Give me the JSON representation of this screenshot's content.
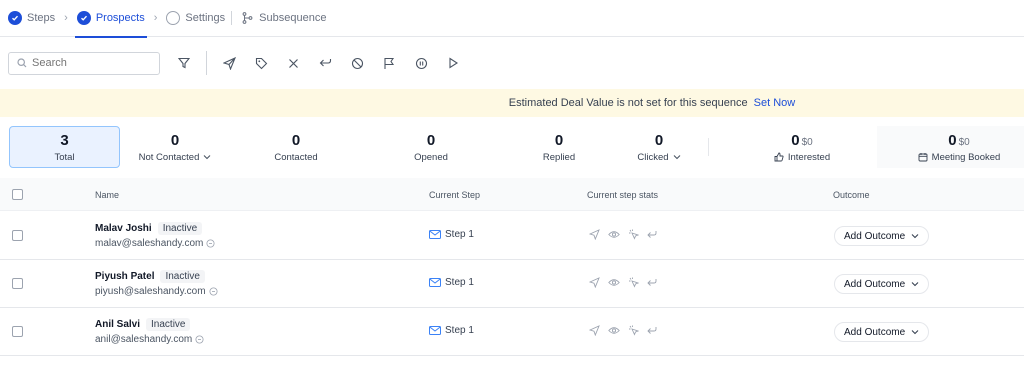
{
  "tabs": [
    {
      "label": "Steps",
      "state": "done"
    },
    {
      "label": "Prospects",
      "state": "active"
    },
    {
      "label": "Settings",
      "state": "empty"
    },
    {
      "label": "Subsequence",
      "state": "branch"
    }
  ],
  "toolbar": {
    "search_placeholder": "Search",
    "icons": [
      "filter-icon",
      "send-icon",
      "tag-icon",
      "close-icon",
      "reply-icon",
      "block-icon",
      "flag-icon",
      "pause-icon",
      "play-icon"
    ]
  },
  "banner": {
    "text": "Estimated Deal Value is not set for this sequence",
    "link": "Set Now"
  },
  "stats": {
    "total": {
      "value": "3",
      "label": "Total"
    },
    "not_contacted": {
      "value": "0",
      "label": "Not Contacted"
    },
    "contacted": {
      "value": "0",
      "label": "Contacted"
    },
    "opened": {
      "value": "0",
      "label": "Opened"
    },
    "replied": {
      "value": "0",
      "label": "Replied"
    },
    "clicked": {
      "value": "0",
      "label": "Clicked"
    },
    "interested": {
      "value": "0",
      "amount": "$0",
      "label": "Interested"
    },
    "meeting_booked": {
      "value": "0",
      "amount": "$0",
      "label": "Meeting Booked"
    }
  },
  "table": {
    "headers": {
      "name": "Name",
      "current_step": "Current Step",
      "step_stats": "Current step stats",
      "outcome": "Outcome"
    },
    "rows": [
      {
        "name": "Malav Joshi",
        "status": "Inactive",
        "email": "malav@saleshandy.com",
        "step": "Step 1",
        "outcome": "Add Outcome"
      },
      {
        "name": "Piyush Patel",
        "status": "Inactive",
        "email": "piyush@saleshandy.com",
        "step": "Step 1",
        "outcome": "Add Outcome"
      },
      {
        "name": "Anil Salvi",
        "status": "Inactive",
        "email": "anil@saleshandy.com",
        "step": "Step 1",
        "outcome": "Add Outcome"
      }
    ]
  },
  "colors": {
    "accent": "#1d4ed8",
    "banner_bg": "#fef9e3",
    "total_bg": "#eaf2ff"
  }
}
